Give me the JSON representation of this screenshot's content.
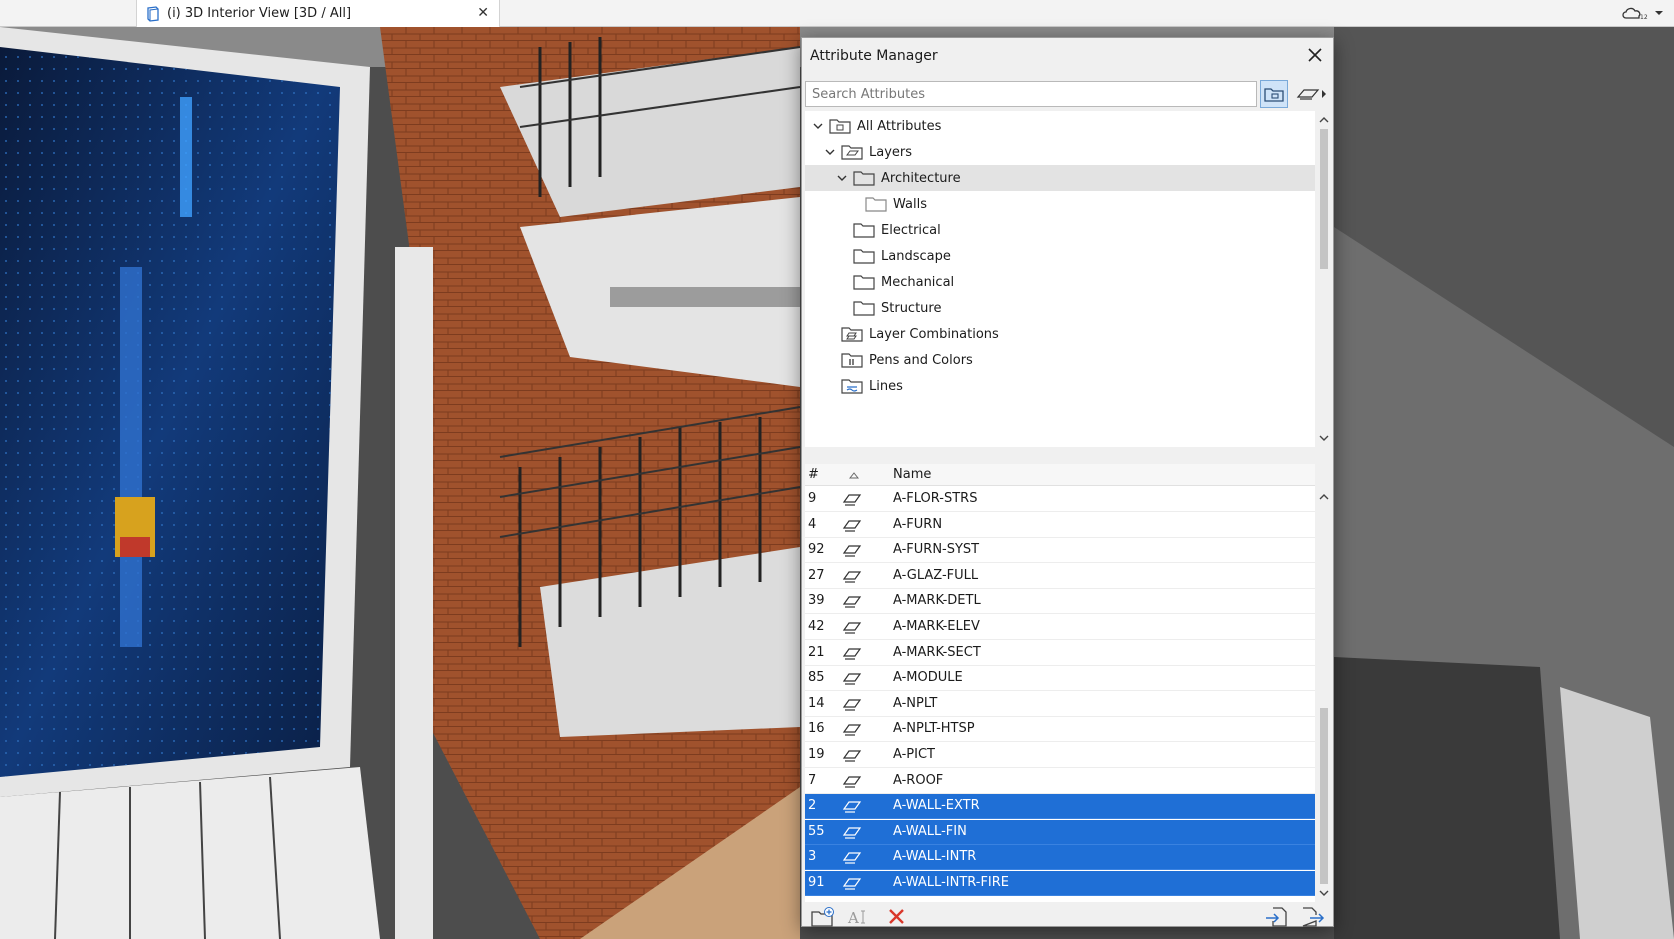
{
  "tab": {
    "label": "(i) 3D Interior View [3D / All]"
  },
  "dialog": {
    "title": "Attribute Manager",
    "search_placeholder": "Search Attributes",
    "tree": [
      {
        "label": "All Attributes"
      },
      {
        "label": "Layers"
      },
      {
        "label": "Architecture"
      },
      {
        "label": "Walls"
      },
      {
        "label": "Electrical"
      },
      {
        "label": "Landscape"
      },
      {
        "label": "Mechanical"
      },
      {
        "label": "Structure"
      },
      {
        "label": "Layer Combinations"
      },
      {
        "label": "Pens and Colors"
      },
      {
        "label": "Lines"
      }
    ],
    "table": {
      "col_num": "#",
      "col_name": "Name",
      "rows": [
        {
          "num": "9",
          "name": "A-FLOR-STRS"
        },
        {
          "num": "4",
          "name": "A-FURN"
        },
        {
          "num": "92",
          "name": "A-FURN-SYST"
        },
        {
          "num": "27",
          "name": "A-GLAZ-FULL"
        },
        {
          "num": "39",
          "name": "A-MARK-DETL"
        },
        {
          "num": "42",
          "name": "A-MARK-ELEV"
        },
        {
          "num": "21",
          "name": "A-MARK-SECT"
        },
        {
          "num": "85",
          "name": "A-MODULE"
        },
        {
          "num": "14",
          "name": "A-NPLT"
        },
        {
          "num": "16",
          "name": "A-NPLT-HTSP"
        },
        {
          "num": "19",
          "name": "A-PICT"
        },
        {
          "num": "7",
          "name": "A-ROOF"
        },
        {
          "num": "2",
          "name": "A-WALL-EXTR"
        },
        {
          "num": "55",
          "name": "A-WALL-FIN"
        },
        {
          "num": "3",
          "name": "A-WALL-INTR"
        },
        {
          "num": "91",
          "name": "A-WALL-INTR-FIRE"
        }
      ]
    }
  },
  "colors": {
    "selection": "#1f6fd6",
    "delete": "#d9382b"
  }
}
